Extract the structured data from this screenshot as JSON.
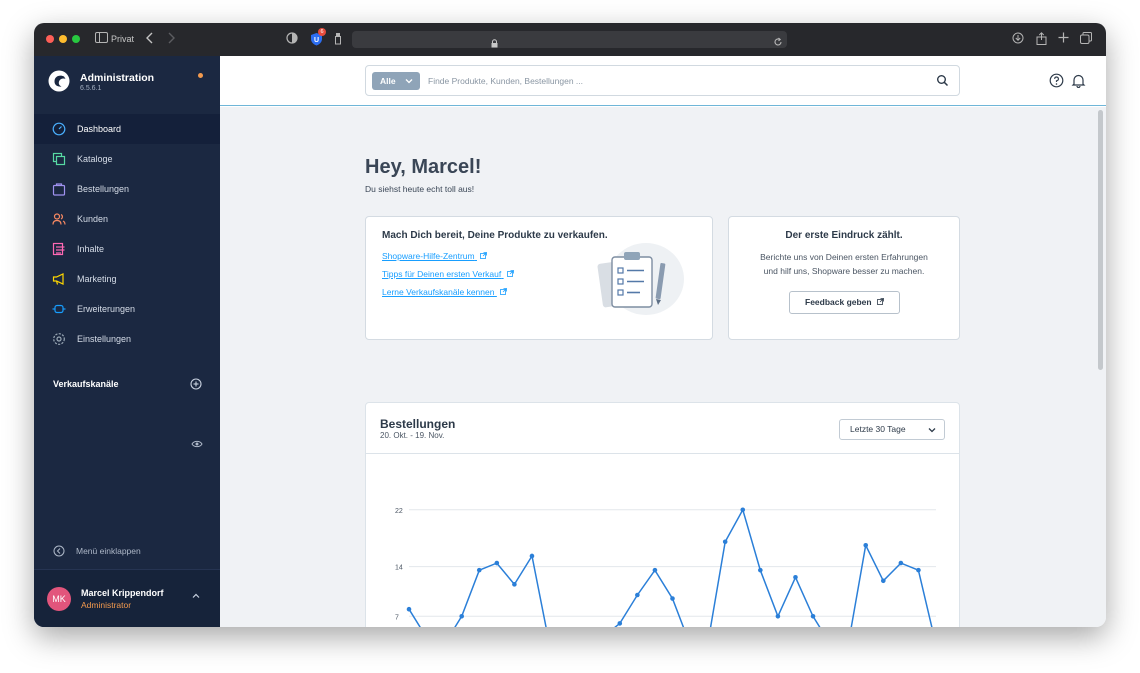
{
  "browser": {
    "private_label": "Privat",
    "shield_badge": "6"
  },
  "sidebar": {
    "app_title": "Administration",
    "version": "6.5.6.1",
    "items": [
      {
        "label": "Dashboard",
        "icon": "dashboard-icon"
      },
      {
        "label": "Kataloge",
        "icon": "catalog-icon"
      },
      {
        "label": "Bestellungen",
        "icon": "orders-icon"
      },
      {
        "label": "Kunden",
        "icon": "customers-icon"
      },
      {
        "label": "Inhalte",
        "icon": "content-icon"
      },
      {
        "label": "Marketing",
        "icon": "marketing-icon"
      },
      {
        "label": "Erweiterungen",
        "icon": "extensions-icon"
      },
      {
        "label": "Einstellungen",
        "icon": "settings-icon"
      }
    ],
    "sales_channels_title": "Verkaufskanäle",
    "collapse_label": "Menü einklappen",
    "user": {
      "initials": "MK",
      "name": "Marcel Krippendorf",
      "role": "Administrator"
    },
    "colors": {
      "background": "#1b2841",
      "accent": "#f39a4e",
      "avatar": "#e2557c"
    }
  },
  "search": {
    "type_label": "Alle",
    "placeholder": "Finde Produkte, Kunden, Bestellungen ..."
  },
  "main": {
    "greeting": "Hey, Marcel!",
    "subgreeting": "Du siehst heute echt toll aus!",
    "getting_started": {
      "title": "Mach Dich bereit, Deine Produkte zu verkaufen.",
      "links": [
        "Shopware-Hilfe-Zentrum",
        "Tipps für Deinen ersten Verkauf",
        "Lerne Verkaufskanäle kennen"
      ]
    },
    "feedback": {
      "title": "Der erste Eindruck zählt.",
      "text_line1": "Berichte uns von Deinen ersten Erfahrungen",
      "text_line2": "und hilf uns, Shopware besser zu machen.",
      "button": "Feedback geben"
    },
    "orders": {
      "title": "Bestellungen",
      "range": "20. Okt. - 19. Nov.",
      "period": "Letzte 30 Tage"
    }
  },
  "chart_data": {
    "type": "line",
    "title": "",
    "xlabel": "",
    "ylabel": "",
    "y_ticks": [
      7,
      14,
      22
    ],
    "ylim": [
      0,
      22
    ],
    "grid": true,
    "color": "#2b7fd8",
    "series": [
      {
        "values": [
          8,
          4,
          3,
          7,
          13.5,
          14.5,
          11.5,
          15.5,
          3,
          3,
          3,
          4,
          6,
          10,
          13.5,
          9.5,
          3,
          3,
          17.5,
          22,
          13.5,
          7,
          12.5,
          7,
          3,
          3,
          17,
          12,
          14.5,
          13.5,
          3
        ]
      }
    ]
  }
}
